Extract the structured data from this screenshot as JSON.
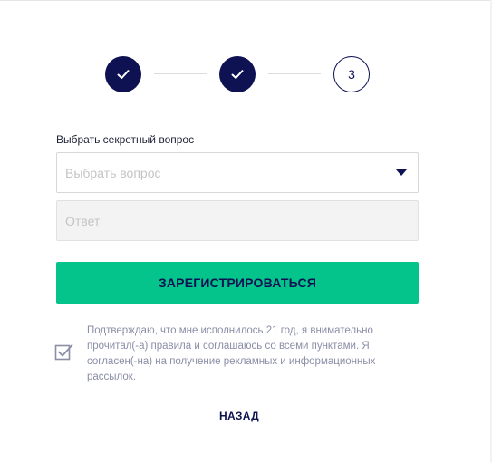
{
  "stepper": {
    "steps": [
      {
        "state": "completed",
        "icon": "check-icon"
      },
      {
        "state": "completed",
        "icon": "check-icon"
      },
      {
        "state": "current",
        "label": "3"
      }
    ]
  },
  "form": {
    "label": "Выбрать секретный вопрос",
    "select_placeholder": "Выбрать вопрос",
    "answer_placeholder": "Ответ",
    "submit_label": "ЗАРЕГИСТРИРОВАТЬСЯ"
  },
  "consent": {
    "checked": true,
    "lines": [
      "Подтверждаю, что мне исполнилось 21 год, я внимательно",
      "прочитал(-а) правила и соглашаюсь со всеми пунктами. Я",
      "согласен(-на) на получение рекламных и информационных",
      "рассылок."
    ]
  },
  "back_label": "НАЗАД",
  "colors": {
    "navy": "#0e1152",
    "accent_green": "#04c48b",
    "muted_text": "#8a8ea6"
  }
}
